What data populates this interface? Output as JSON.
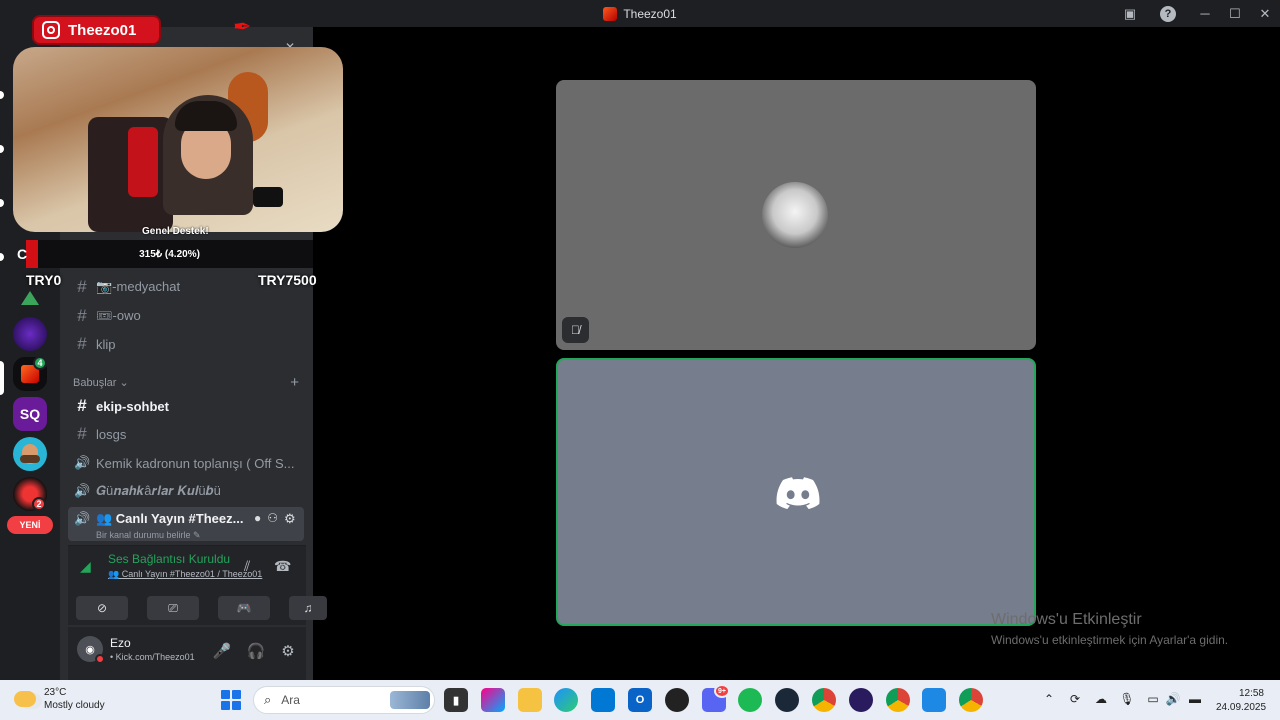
{
  "window": {
    "title": "Theezo01"
  },
  "stream_overlay": {
    "instagram_handle": "Theezo01",
    "goal_label": "Genel Destek!",
    "goal_progress_text": "315₺ (4.20%)",
    "goal_progress_fraction": 0.042,
    "goal_min": "TRY0",
    "goal_max": "TRY7500",
    "cut_letter": "C"
  },
  "channels": {
    "top": [
      {
        "name": "📷-medyachat",
        "icon": "#"
      },
      {
        "name": "🎟-owo",
        "icon": "#"
      },
      {
        "name": "klip",
        "icon": "#"
      }
    ],
    "category": "Babuşlar",
    "list": [
      {
        "name": "ekip-sohbet",
        "icon": "#",
        "bright": true
      },
      {
        "name": "losgs",
        "icon": "#"
      },
      {
        "name": "Kemik kadronun toplanışı ( Off S...",
        "icon": "speaker"
      },
      {
        "name": "𝑮ü𝒏𝒂𝒉𝒌â𝒓𝒍𝒂𝒓 𝑲𝒖𝒍ü𝒃ü",
        "icon": "speaker"
      }
    ],
    "active": {
      "name": "👥 Canlı Yayın #Theez...",
      "sub": "Bir kanal durumu belirle ✎"
    }
  },
  "voice": {
    "status": "Ses Bağlantısı Kuruldu",
    "channel": "👥 Canlı Yayın #Theezo01 / Theezo01"
  },
  "user": {
    "name": "Ezo",
    "status": "• Kick.com/Theezo01"
  },
  "rail": {
    "badge_a": "4",
    "badge_b": "2",
    "new_label": "YENİ",
    "sq_label": "SQ"
  },
  "watermark": {
    "title": "Windows'u Etkinleştir",
    "subtitle": "Windows'u etkinleştirmek için Ayarlar'a gidin."
  },
  "taskbar": {
    "temp": "23°C",
    "weather": "Mostly cloudy",
    "search_placeholder": "Ara",
    "time": "12:58",
    "date": "24.09.2025",
    "discord_badge": "9+"
  }
}
